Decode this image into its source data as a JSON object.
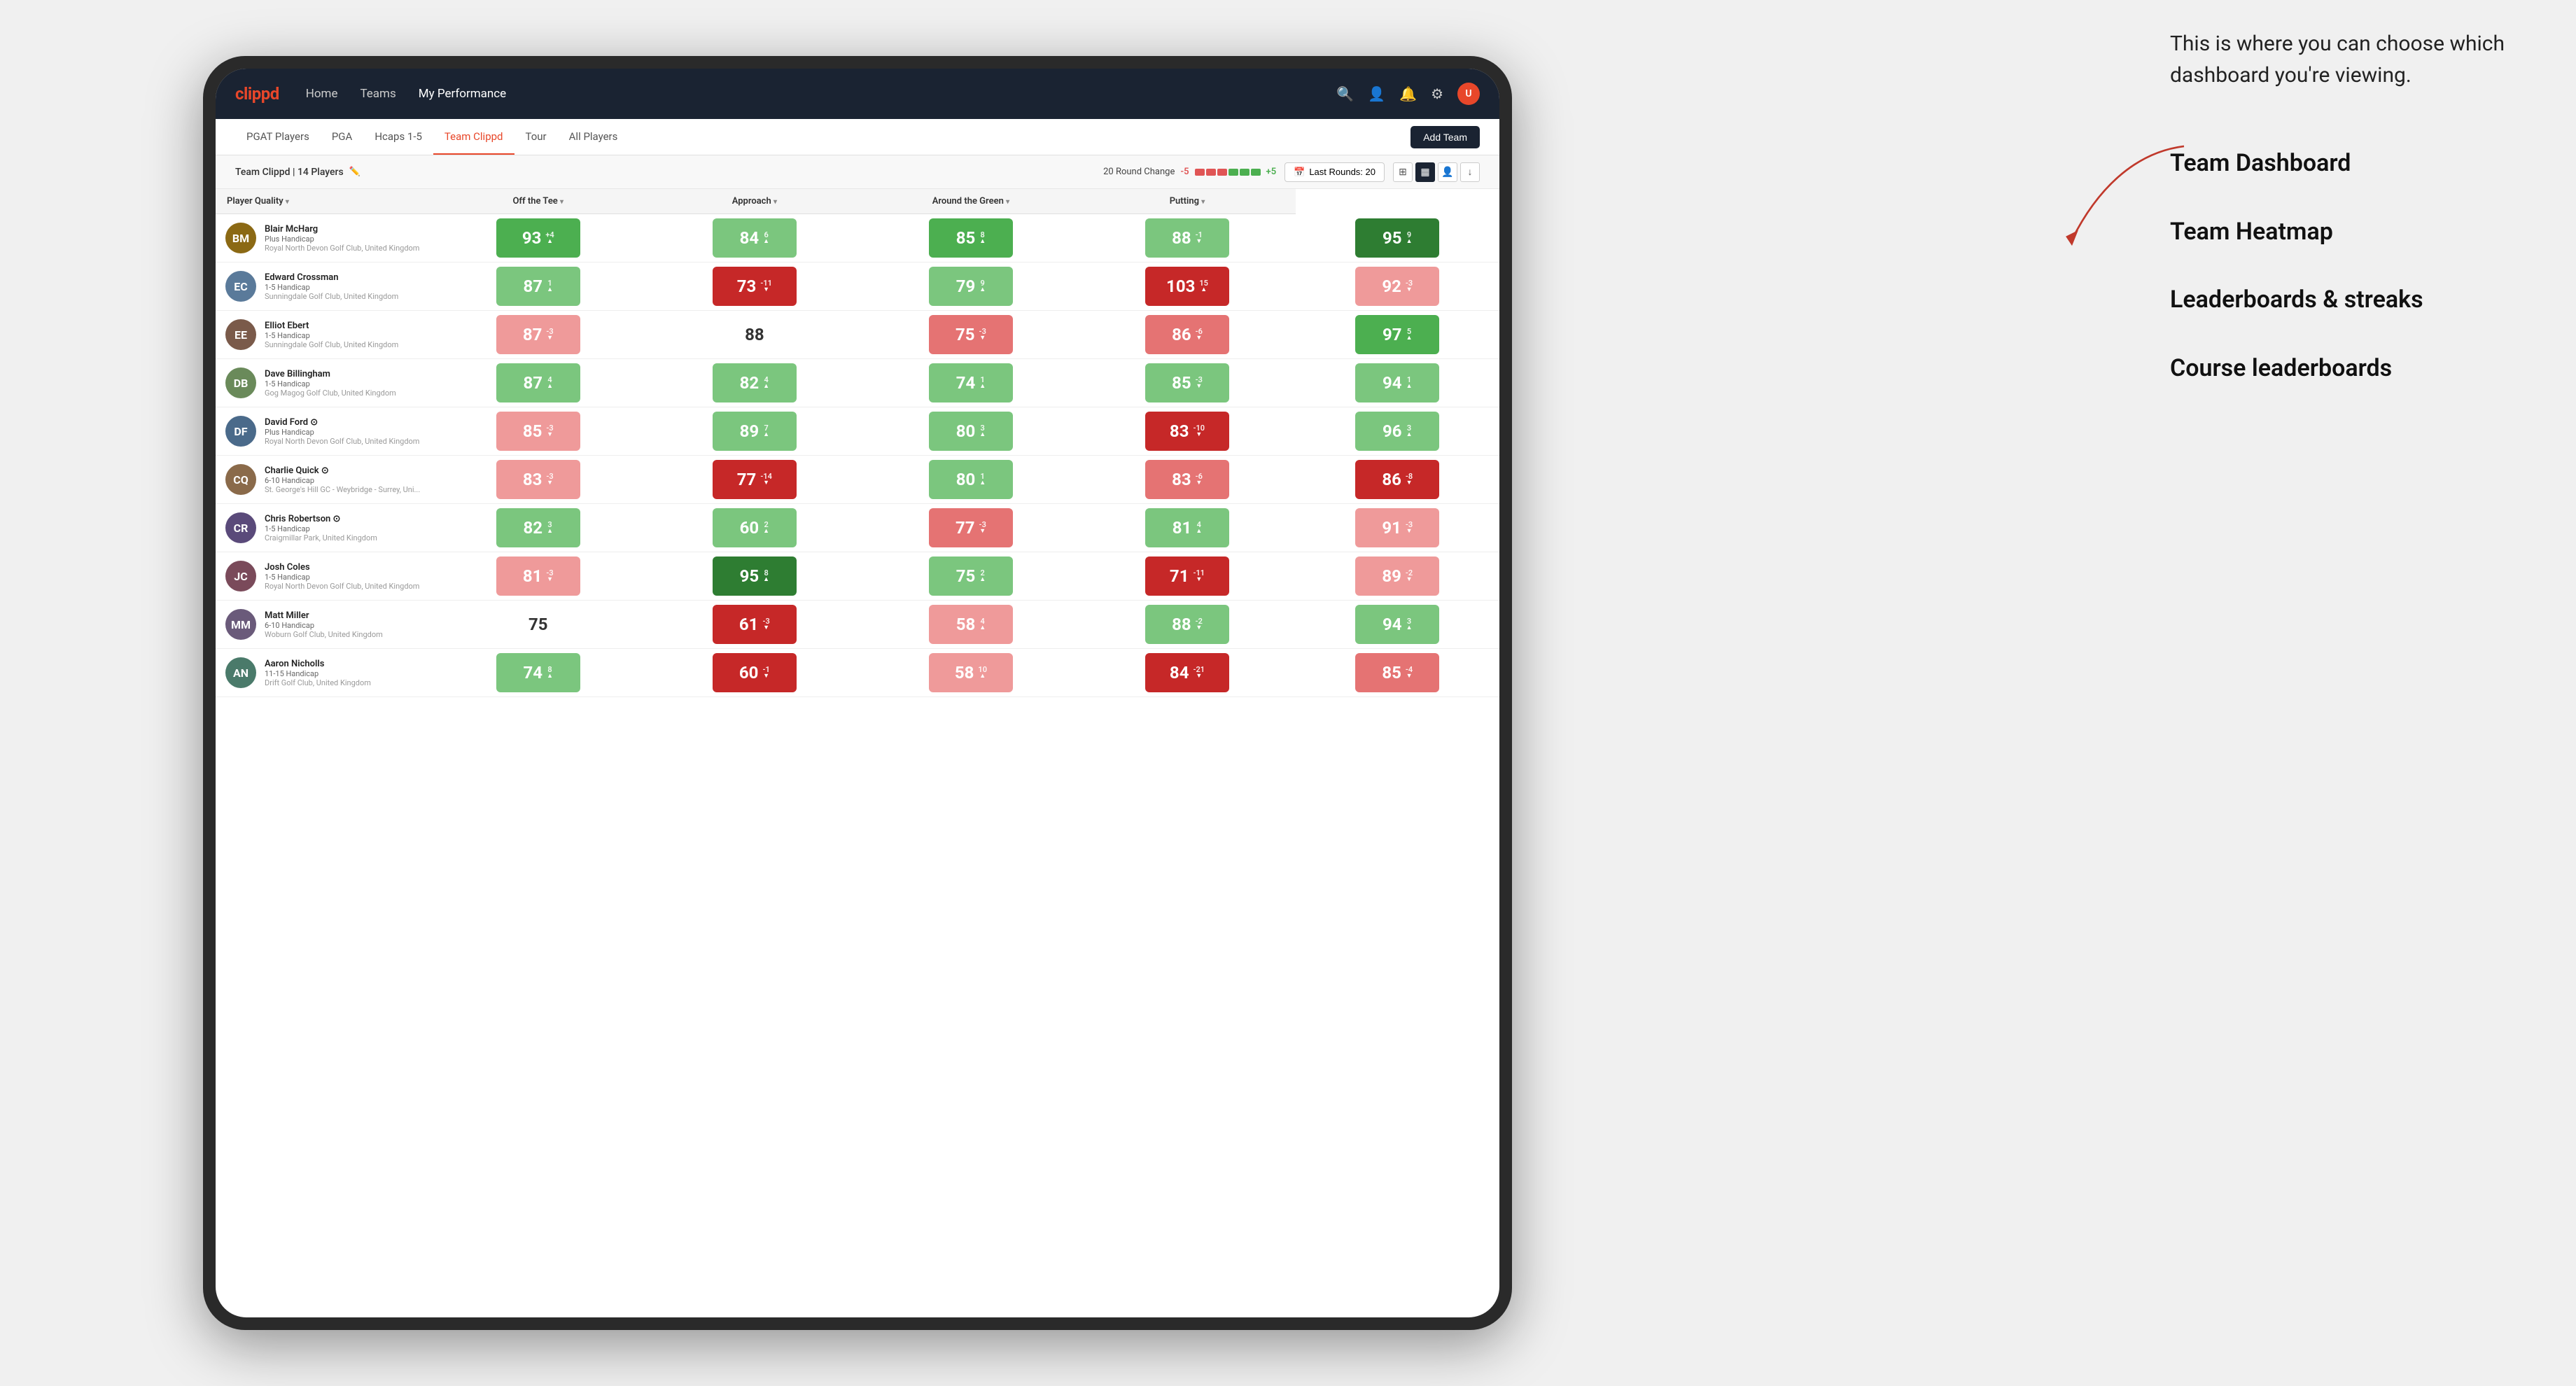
{
  "annotation": {
    "intro_text": "This is where you can choose which dashboard you're viewing.",
    "options": [
      "Team Dashboard",
      "Team Heatmap",
      "Leaderboards & streaks",
      "Course leaderboards"
    ]
  },
  "nav": {
    "logo": "clippd",
    "links": [
      "Home",
      "Teams",
      "My Performance"
    ],
    "active_link": "My Performance"
  },
  "sub_nav": {
    "links": [
      "PGAT Players",
      "PGA",
      "Hcaps 1-5",
      "Team Clippd",
      "Tour",
      "All Players"
    ],
    "active_link": "Team Clippd",
    "add_team_label": "Add Team"
  },
  "team_bar": {
    "name": "Team Clippd",
    "player_count": "14 Players",
    "round_change_label": "20 Round Change",
    "round_change_minus": "-5",
    "round_change_plus": "+5",
    "last_rounds_label": "Last Rounds: 20"
  },
  "table": {
    "headers": [
      "Player Quality ▾",
      "Off the Tee ▾",
      "Approach ▾",
      "Around the Green ▾",
      "Putting ▾"
    ],
    "players": [
      {
        "name": "Blair McHarg",
        "handicap": "Plus Handicap",
        "club": "Royal North Devon Golf Club, United Kingdom",
        "avatar_color": "#8B6914",
        "scores": [
          {
            "value": 93,
            "delta": "+4",
            "direction": "up",
            "color": "green-mid"
          },
          {
            "value": 84,
            "delta": "6",
            "direction": "up",
            "color": "green-light"
          },
          {
            "value": 85,
            "delta": "8",
            "direction": "up",
            "color": "green-mid"
          },
          {
            "value": 88,
            "delta": "-1",
            "direction": "down",
            "color": "green-light"
          },
          {
            "value": 95,
            "delta": "9",
            "direction": "up",
            "color": "green-dark"
          }
        ]
      },
      {
        "name": "Edward Crossman",
        "handicap": "1-5 Handicap",
        "club": "Sunningdale Golf Club, United Kingdom",
        "avatar_color": "#5a7a9a",
        "scores": [
          {
            "value": 87,
            "delta": "1",
            "direction": "up",
            "color": "green-light"
          },
          {
            "value": 73,
            "delta": "-11",
            "direction": "down",
            "color": "red-dark"
          },
          {
            "value": 79,
            "delta": "9",
            "direction": "up",
            "color": "green-light"
          },
          {
            "value": 103,
            "delta": "15",
            "direction": "up",
            "color": "red-dark"
          },
          {
            "value": 92,
            "delta": "-3",
            "direction": "down",
            "color": "red-light"
          }
        ]
      },
      {
        "name": "Elliot Ebert",
        "handicap": "1-5 Handicap",
        "club": "Sunningdale Golf Club, United Kingdom",
        "avatar_color": "#7a5a4a",
        "scores": [
          {
            "value": 87,
            "delta": "-3",
            "direction": "down",
            "color": "red-light"
          },
          {
            "value": 88,
            "delta": "",
            "direction": "none",
            "color": "white-bg"
          },
          {
            "value": 75,
            "delta": "-3",
            "direction": "down",
            "color": "red-mid"
          },
          {
            "value": 86,
            "delta": "-6",
            "direction": "down",
            "color": "red-mid"
          },
          {
            "value": 97,
            "delta": "5",
            "direction": "up",
            "color": "green-mid"
          }
        ]
      },
      {
        "name": "Dave Billingham",
        "handicap": "1-5 Handicap",
        "club": "Gog Magog Golf Club, United Kingdom",
        "avatar_color": "#6a8a5a",
        "scores": [
          {
            "value": 87,
            "delta": "4",
            "direction": "up",
            "color": "green-light"
          },
          {
            "value": 82,
            "delta": "4",
            "direction": "up",
            "color": "green-light"
          },
          {
            "value": 74,
            "delta": "1",
            "direction": "up",
            "color": "green-light"
          },
          {
            "value": 85,
            "delta": "-3",
            "direction": "down",
            "color": "green-light"
          },
          {
            "value": 94,
            "delta": "1",
            "direction": "up",
            "color": "green-light"
          }
        ]
      },
      {
        "name": "David Ford ⊙",
        "handicap": "Plus Handicap",
        "club": "Royal North Devon Golf Club, United Kingdom",
        "avatar_color": "#4a6a8a",
        "scores": [
          {
            "value": 85,
            "delta": "-3",
            "direction": "down",
            "color": "red-light"
          },
          {
            "value": 89,
            "delta": "7",
            "direction": "up",
            "color": "green-light"
          },
          {
            "value": 80,
            "delta": "3",
            "direction": "up",
            "color": "green-light"
          },
          {
            "value": 83,
            "delta": "-10",
            "direction": "down",
            "color": "red-dark"
          },
          {
            "value": 96,
            "delta": "3",
            "direction": "up",
            "color": "green-light"
          }
        ]
      },
      {
        "name": "Charlie Quick ⊙",
        "handicap": "6-10 Handicap",
        "club": "St. George's Hill GC - Weybridge - Surrey, Uni...",
        "avatar_color": "#8a6a4a",
        "scores": [
          {
            "value": 83,
            "delta": "-3",
            "direction": "down",
            "color": "red-light"
          },
          {
            "value": 77,
            "delta": "-14",
            "direction": "down",
            "color": "red-dark"
          },
          {
            "value": 80,
            "delta": "1",
            "direction": "up",
            "color": "green-light"
          },
          {
            "value": 83,
            "delta": "-6",
            "direction": "down",
            "color": "red-mid"
          },
          {
            "value": 86,
            "delta": "-8",
            "direction": "down",
            "color": "red-dark"
          }
        ]
      },
      {
        "name": "Chris Robertson ⊙",
        "handicap": "1-5 Handicap",
        "club": "Craigmillar Park, United Kingdom",
        "avatar_color": "#5a4a7a",
        "scores": [
          {
            "value": 82,
            "delta": "3",
            "direction": "up",
            "color": "green-light"
          },
          {
            "value": 60,
            "delta": "2",
            "direction": "up",
            "color": "green-light"
          },
          {
            "value": 77,
            "delta": "-3",
            "direction": "down",
            "color": "red-mid"
          },
          {
            "value": 81,
            "delta": "4",
            "direction": "up",
            "color": "green-light"
          },
          {
            "value": 91,
            "delta": "-3",
            "direction": "down",
            "color": "red-light"
          }
        ]
      },
      {
        "name": "Josh Coles",
        "handicap": "1-5 Handicap",
        "club": "Royal North Devon Golf Club, United Kingdom",
        "avatar_color": "#7a4a5a",
        "scores": [
          {
            "value": 81,
            "delta": "-3",
            "direction": "down",
            "color": "red-light"
          },
          {
            "value": 95,
            "delta": "8",
            "direction": "up",
            "color": "green-dark"
          },
          {
            "value": 75,
            "delta": "2",
            "direction": "up",
            "color": "green-light"
          },
          {
            "value": 71,
            "delta": "-11",
            "direction": "down",
            "color": "red-dark"
          },
          {
            "value": 89,
            "delta": "-2",
            "direction": "down",
            "color": "red-light"
          }
        ]
      },
      {
        "name": "Matt Miller",
        "handicap": "6-10 Handicap",
        "club": "Woburn Golf Club, United Kingdom",
        "avatar_color": "#6a5a7a",
        "scores": [
          {
            "value": 75,
            "delta": "",
            "direction": "none",
            "color": "white-bg"
          },
          {
            "value": 61,
            "delta": "-3",
            "direction": "down",
            "color": "red-dark"
          },
          {
            "value": 58,
            "delta": "4",
            "direction": "up",
            "color": "red-light"
          },
          {
            "value": 88,
            "delta": "-2",
            "direction": "down",
            "color": "green-light"
          },
          {
            "value": 94,
            "delta": "3",
            "direction": "up",
            "color": "green-light"
          }
        ]
      },
      {
        "name": "Aaron Nicholls",
        "handicap": "11-15 Handicap",
        "club": "Drift Golf Club, United Kingdom",
        "avatar_color": "#4a7a6a",
        "scores": [
          {
            "value": 74,
            "delta": "8",
            "direction": "up",
            "color": "green-light"
          },
          {
            "value": 60,
            "delta": "-1",
            "direction": "down",
            "color": "red-dark"
          },
          {
            "value": 58,
            "delta": "10",
            "direction": "up",
            "color": "red-light"
          },
          {
            "value": 84,
            "delta": "-21",
            "direction": "down",
            "color": "red-dark"
          },
          {
            "value": 85,
            "delta": "-4",
            "direction": "down",
            "color": "red-mid"
          }
        ]
      }
    ]
  }
}
